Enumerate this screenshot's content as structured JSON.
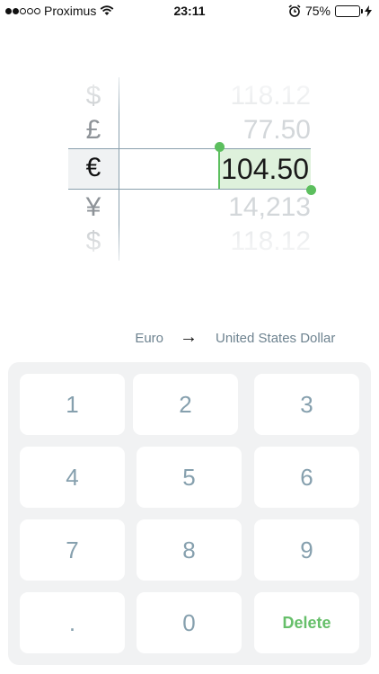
{
  "status_bar": {
    "carrier": "Proximus",
    "time": "23:11",
    "battery_percent": "75%",
    "battery_level": 0.75
  },
  "wheel": {
    "rows": [
      {
        "symbol": "$",
        "value": "118.12"
      },
      {
        "symbol": "£",
        "value": "77.50"
      },
      {
        "symbol": "€",
        "value": "104.50"
      },
      {
        "symbol": "¥",
        "value": "14,213"
      },
      {
        "symbol": "$",
        "value": "118.12"
      }
    ],
    "selected_index": 2
  },
  "direction": {
    "from": "Euro",
    "to": "United States Dollar"
  },
  "keypad": {
    "keys": [
      "1",
      "2",
      "3",
      "4",
      "5",
      "6",
      "7",
      "8",
      "9",
      ".",
      "0",
      "Delete"
    ]
  },
  "colors": {
    "accent": "#5cbf5e",
    "key_text": "#86a0ae",
    "selection_bg": "#def1dc"
  }
}
